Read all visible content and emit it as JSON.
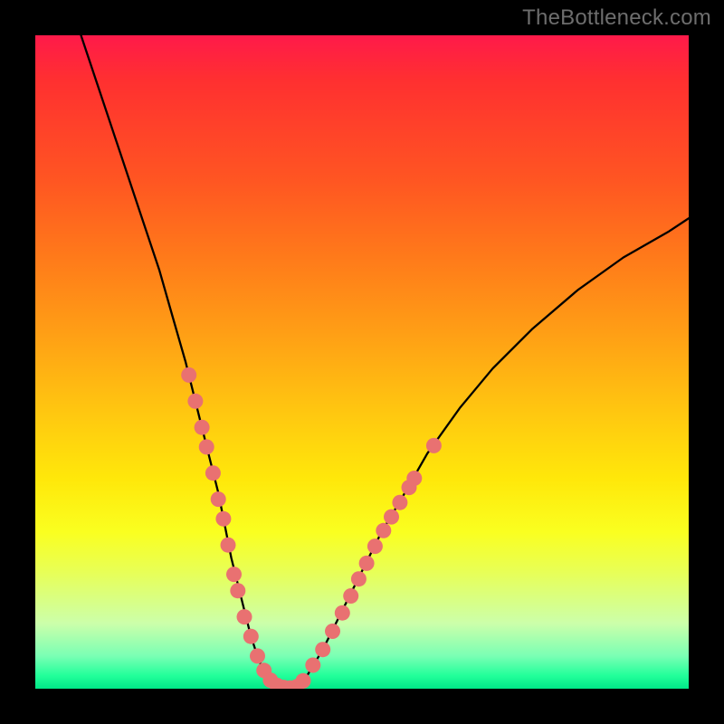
{
  "watermark": "TheBottleneck.com",
  "colors": {
    "frame": "#000000",
    "curve": "#000000",
    "marker": "#e97171",
    "gradient_top": "#ff1a4a",
    "gradient_bottom": "#00e888"
  },
  "chart_data": {
    "type": "line",
    "title": "",
    "xlabel": "",
    "ylabel": "",
    "xlim": [
      0,
      100
    ],
    "ylim": [
      0,
      100
    ],
    "grid": false,
    "legend": false,
    "curve": {
      "x": [
        7,
        10,
        13,
        16,
        19,
        21,
        23,
        25,
        26.5,
        28,
        29,
        30,
        31,
        32,
        33,
        34,
        35,
        36,
        37,
        38,
        39.5,
        41,
        44,
        47,
        50,
        53,
        56,
        60,
        65,
        70,
        76,
        83,
        90,
        97,
        100
      ],
      "y": [
        100,
        91,
        82,
        73,
        64,
        57,
        50,
        42,
        36,
        30,
        25,
        20,
        16,
        12,
        8,
        5,
        2.5,
        1,
        0.3,
        0,
        0,
        1,
        6,
        12,
        18,
        24,
        29,
        36,
        43,
        49,
        55,
        61,
        66,
        70,
        72
      ]
    },
    "markers": [
      {
        "x": 23.5,
        "y": 48
      },
      {
        "x": 24.5,
        "y": 44
      },
      {
        "x": 25.5,
        "y": 40
      },
      {
        "x": 26.2,
        "y": 37
      },
      {
        "x": 27.2,
        "y": 33
      },
      {
        "x": 28.0,
        "y": 29
      },
      {
        "x": 28.8,
        "y": 26
      },
      {
        "x": 29.5,
        "y": 22
      },
      {
        "x": 30.4,
        "y": 17.5
      },
      {
        "x": 31.0,
        "y": 15
      },
      {
        "x": 32.0,
        "y": 11
      },
      {
        "x": 33.0,
        "y": 8
      },
      {
        "x": 34.0,
        "y": 5
      },
      {
        "x": 35.0,
        "y": 2.8
      },
      {
        "x": 36.0,
        "y": 1.3
      },
      {
        "x": 37.0,
        "y": 0.5
      },
      {
        "x": 38.0,
        "y": 0.2
      },
      {
        "x": 39.0,
        "y": 0.1
      },
      {
        "x": 40.0,
        "y": 0.3
      },
      {
        "x": 41.0,
        "y": 1.2
      },
      {
        "x": 42.5,
        "y": 3.6
      },
      {
        "x": 44.0,
        "y": 6.0
      },
      {
        "x": 45.5,
        "y": 8.8
      },
      {
        "x": 47.0,
        "y": 11.6
      },
      {
        "x": 48.3,
        "y": 14.2
      },
      {
        "x": 49.5,
        "y": 16.8
      },
      {
        "x": 50.7,
        "y": 19.2
      },
      {
        "x": 52.0,
        "y": 21.8
      },
      {
        "x": 53.3,
        "y": 24.2
      },
      {
        "x": 54.5,
        "y": 26.3
      },
      {
        "x": 55.8,
        "y": 28.5
      },
      {
        "x": 57.2,
        "y": 30.8
      },
      {
        "x": 58.0,
        "y": 32.2
      },
      {
        "x": 61.0,
        "y": 37.2
      }
    ]
  }
}
